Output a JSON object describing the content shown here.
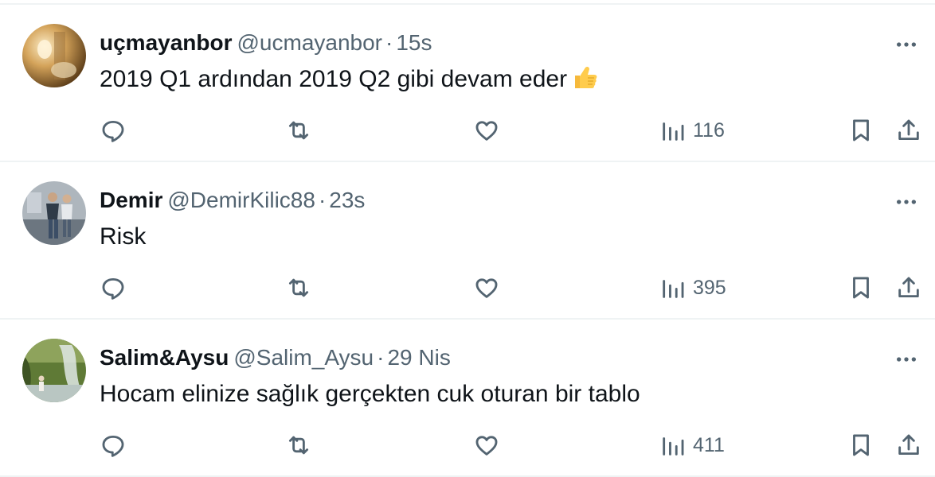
{
  "tweets": [
    {
      "display_name": "uçmayanbor",
      "handle": "@ucmayanbor",
      "separator": "·",
      "time": "15s",
      "text": "2019 Q1 ardından 2019 Q2 gibi devam eder",
      "emoji_icon": "thumbs-up-emoji",
      "views": "116",
      "avatar_colors": [
        "#c99a4f",
        "#f5e2b4",
        "#7a5a2e"
      ]
    },
    {
      "display_name": "Demir",
      "handle": "@DemirKilic88",
      "separator": "·",
      "time": "23s",
      "text": "Risk",
      "views": "395",
      "avatar_colors": [
        "#9aa4ad",
        "#3a4a5c",
        "#d9c4ac"
      ]
    },
    {
      "display_name": "Salim&Aysu",
      "handle": "@Salim_Aysu",
      "separator": "·",
      "time": "29 Nis",
      "text": "Hocam elinize sağlık gerçekten cuk oturan bir tablo",
      "views": "411",
      "avatar_colors": [
        "#6f8a3f",
        "#c6d2c2",
        "#3b4d2a"
      ]
    }
  ],
  "icons": {
    "reply": "reply-icon",
    "retweet": "retweet-icon",
    "like": "like-icon",
    "views": "views-icon",
    "bookmark": "bookmark-icon",
    "share": "share-icon",
    "more": "more-icon"
  },
  "colors": {
    "text_primary": "#0f1419",
    "text_secondary": "#536471",
    "divider": "#eff3f4"
  }
}
